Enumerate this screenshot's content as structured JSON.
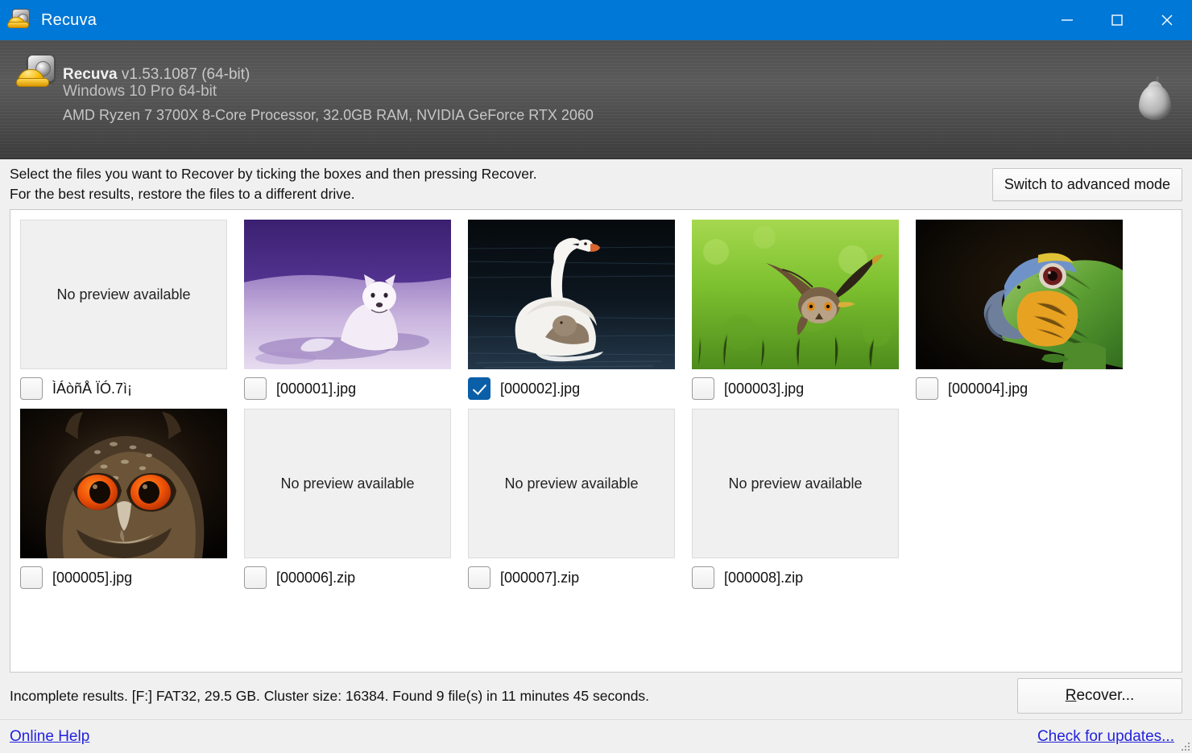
{
  "titlebar": {
    "app_title": "Recuva",
    "icon": "recuva-disk-hardhat-icon",
    "minimize_label": "Minimize",
    "maximize_label": "Maximize",
    "close_label": "Close",
    "bg_color": "#0078d7"
  },
  "banner": {
    "app_name": "Recuva",
    "version": "v1.53.1087 (64-bit)",
    "os": "Windows 10 Pro 64-bit",
    "hardware": "AMD Ryzen 7 3700X 8-Core Processor, 32.0GB RAM, NVIDIA GeForce RTX 2060",
    "logo": "piriform-pear-logo"
  },
  "instructions": {
    "line1": "Select the files you want to Recover by ticking the boxes and then pressing Recover.",
    "line2": "For the best results, restore the files to a different drive.",
    "advanced_mode_button": "Switch to advanced mode"
  },
  "grid": {
    "no_preview_text": "No preview available",
    "files": [
      {
        "name": "ÌÁòñÅ ÏÓ.7ì¡",
        "checked": false,
        "preview": "none"
      },
      {
        "name": "[000001].jpg",
        "checked": false,
        "preview": "arctic-fox"
      },
      {
        "name": "[000002].jpg",
        "checked": true,
        "preview": "swan"
      },
      {
        "name": "[000003].jpg",
        "checked": false,
        "preview": "owl-flying"
      },
      {
        "name": "[000004].jpg",
        "checked": false,
        "preview": "parrot"
      },
      {
        "name": "[000005].jpg",
        "checked": false,
        "preview": "owl-eyes"
      },
      {
        "name": "[000006].zip",
        "checked": false,
        "preview": "none"
      },
      {
        "name": "[000007].zip",
        "checked": false,
        "preview": "none"
      },
      {
        "name": "[000008].zip",
        "checked": false,
        "preview": "none"
      }
    ]
  },
  "status": {
    "text": "Incomplete results. [F:] FAT32, 29.5 GB. Cluster size: 16384. Found 9 file(s) in 11 minutes 45 seconds.",
    "recover_button_accel": "R",
    "recover_button_rest": "ecover..."
  },
  "footer": {
    "online_help": "Online Help",
    "check_updates": "Check for updates...",
    "link_color": "#2222dd"
  }
}
